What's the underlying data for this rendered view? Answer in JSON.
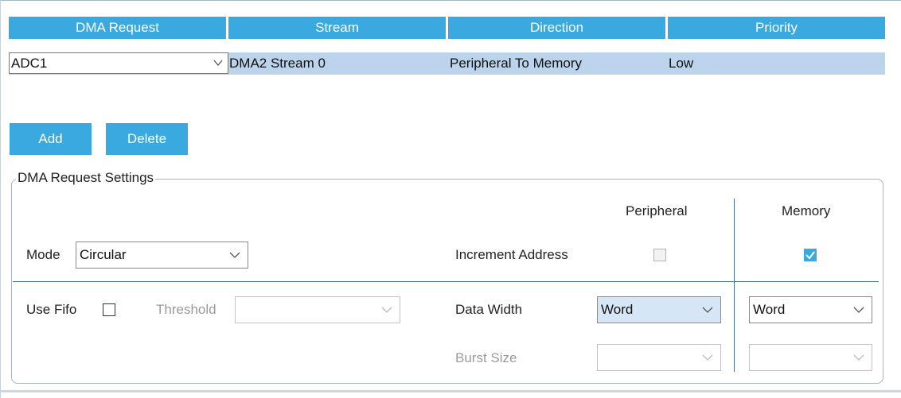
{
  "table": {
    "headers": [
      "DMA Request",
      "Stream",
      "Direction",
      "Priority"
    ],
    "row": {
      "request": "ADC1",
      "stream": "DMA2 Stream 0",
      "direction": "Peripheral To Memory",
      "priority": "Low"
    }
  },
  "buttons": {
    "add": "Add",
    "delete": "Delete"
  },
  "settings": {
    "title": "DMA Request Settings",
    "peripheral_header": "Peripheral",
    "memory_header": "Memory",
    "mode_label": "Mode",
    "mode_value": "Circular",
    "increment_label": "Increment Address",
    "increment_peripheral_checked": false,
    "increment_memory_checked": true,
    "use_fifo_label": "Use Fifo",
    "use_fifo_checked": false,
    "threshold_label": "Threshold",
    "threshold_value": "",
    "data_width_label": "Data Width",
    "data_width_peripheral": "Word",
    "data_width_memory": "Word",
    "burst_size_label": "Burst Size",
    "burst_size_peripheral": "",
    "burst_size_memory": ""
  },
  "colors": {
    "accent": "#3aa9e0",
    "row_selected": "#bcd3ec",
    "separator": "#4a6da3"
  },
  "icons": [
    "chevron-down-icon",
    "checkmark-icon"
  ]
}
